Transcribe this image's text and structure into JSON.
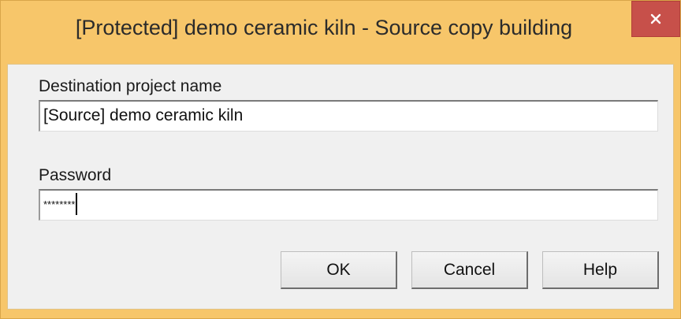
{
  "dialog": {
    "title": "[Protected] demo ceramic kiln - Source copy building",
    "close_icon": "close-icon"
  },
  "form": {
    "destination_label": "Destination project name",
    "destination_value": "[Source] demo ceramic kiln",
    "password_label": "Password",
    "password_value": "********"
  },
  "buttons": {
    "ok": "OK",
    "cancel": "Cancel",
    "help": "Help"
  },
  "colors": {
    "titlebar": "#f7c66a",
    "close_button": "#c7504a",
    "client": "#f0f0f0"
  }
}
